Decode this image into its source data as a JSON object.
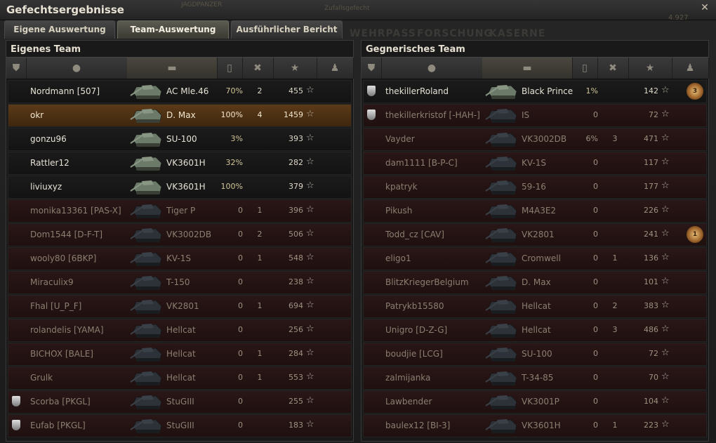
{
  "window": {
    "title": "Gefechtsergebnisse"
  },
  "background_ghosts": {
    "top_left": "JAGDPANZER",
    "top_mid": "Zufallsgefecht",
    "top_right_value": "4.927",
    "nav1": "WEHRPASS",
    "nav2": "FORSCHUNG",
    "nav3": "KASERNE"
  },
  "tabs": [
    {
      "label": "Eigene Auswertung"
    },
    {
      "label": "Team-Auswertung"
    },
    {
      "label": "Ausführlicher Bericht"
    }
  ],
  "column_icons": [
    "badge-icon",
    "player-icon",
    "tank-icon",
    "damage-icon",
    "kills-icon",
    "xp-icon",
    "medal-icon"
  ],
  "own_team": {
    "title": "Eigenes Team",
    "rows": [
      {
        "player": "Nordmann [507]",
        "tank": "AC Mle.46",
        "damage": "70%",
        "kills": "2",
        "xp": "455",
        "status": "alive",
        "badge": false,
        "medal": ""
      },
      {
        "player": "okr",
        "tank": "D. Max",
        "damage": "100%",
        "kills": "4",
        "xp": "1459",
        "status": "self",
        "badge": false,
        "medal": ""
      },
      {
        "player": "gonzu96",
        "tank": "SU-100",
        "damage": "3%",
        "kills": "",
        "xp": "393",
        "status": "alive",
        "badge": false,
        "medal": ""
      },
      {
        "player": "Rattler12",
        "tank": "VK3601H",
        "damage": "32%",
        "kills": "",
        "xp": "282",
        "status": "alive",
        "badge": false,
        "medal": ""
      },
      {
        "player": "liviuxyz",
        "tank": "VK3601H",
        "damage": "100%",
        "kills": "",
        "xp": "379",
        "status": "alive",
        "badge": false,
        "medal": ""
      },
      {
        "player": "monika13361 [PAS-X]",
        "tank": "Tiger P",
        "damage": "0",
        "kills": "1",
        "xp": "396",
        "status": "dead",
        "badge": false,
        "medal": ""
      },
      {
        "player": "Dom1544 [D-F-T]",
        "tank": "VK3002DB",
        "damage": "0",
        "kills": "2",
        "xp": "506",
        "status": "dead",
        "badge": false,
        "medal": ""
      },
      {
        "player": "wooly80 [6BKP]",
        "tank": "KV-1S",
        "damage": "0",
        "kills": "1",
        "xp": "548",
        "status": "dead",
        "badge": false,
        "medal": ""
      },
      {
        "player": "Miraculix9",
        "tank": "T-150",
        "damage": "0",
        "kills": "",
        "xp": "238",
        "status": "dead",
        "badge": false,
        "medal": ""
      },
      {
        "player": "Fhal [U_P_F]",
        "tank": "VK2801",
        "damage": "0",
        "kills": "1",
        "xp": "694",
        "status": "dead",
        "badge": false,
        "medal": ""
      },
      {
        "player": "rolandelis [YAMA]",
        "tank": "Hellcat",
        "damage": "0",
        "kills": "",
        "xp": "256",
        "status": "dead",
        "badge": false,
        "medal": ""
      },
      {
        "player": "BICHOX [BALE]",
        "tank": "Hellcat",
        "damage": "0",
        "kills": "1",
        "xp": "284",
        "status": "dead",
        "badge": false,
        "medal": ""
      },
      {
        "player": "Grulk",
        "tank": "Hellcat",
        "damage": "0",
        "kills": "1",
        "xp": "553",
        "status": "dead",
        "badge": false,
        "medal": ""
      },
      {
        "player": "Scorba [PKGL]",
        "tank": "StuGIII",
        "damage": "0",
        "kills": "",
        "xp": "255",
        "status": "dead",
        "badge": true,
        "medal": ""
      },
      {
        "player": "Eufab [PKGL]",
        "tank": "StuGIII",
        "damage": "0",
        "kills": "",
        "xp": "183",
        "status": "dead",
        "badge": true,
        "medal": ""
      }
    ]
  },
  "enemy_team": {
    "title": "Gegnerisches Team",
    "rows": [
      {
        "player": "thekillerRoland",
        "tank": "Black Prince",
        "damage": "1%",
        "kills": "",
        "xp": "142",
        "status": "alive",
        "badge": true,
        "medal": "3"
      },
      {
        "player": "thekillerkristof [-HAH-]",
        "tank": "IS",
        "damage": "0",
        "kills": "",
        "xp": "72",
        "status": "dead",
        "badge": true,
        "medal": ""
      },
      {
        "player": "Vayder",
        "tank": "VK3002DB",
        "damage": "6%",
        "kills": "3",
        "xp": "471",
        "status": "dead",
        "badge": false,
        "medal": ""
      },
      {
        "player": "dam1111 [B-P-C]",
        "tank": "KV-1S",
        "damage": "0",
        "kills": "",
        "xp": "117",
        "status": "dead",
        "badge": false,
        "medal": ""
      },
      {
        "player": "kpatryk",
        "tank": "59-16",
        "damage": "0",
        "kills": "",
        "xp": "177",
        "status": "dead",
        "badge": false,
        "medal": ""
      },
      {
        "player": "Pikush",
        "tank": "M4A3E2",
        "damage": "0",
        "kills": "",
        "xp": "226",
        "status": "dead",
        "badge": false,
        "medal": ""
      },
      {
        "player": "Todd_cz [CAV]",
        "tank": "VK2801",
        "damage": "0",
        "kills": "",
        "xp": "241",
        "status": "dead",
        "badge": false,
        "medal": "1"
      },
      {
        "player": "eligo1",
        "tank": "Cromwell",
        "damage": "0",
        "kills": "1",
        "xp": "136",
        "status": "dead",
        "badge": false,
        "medal": ""
      },
      {
        "player": "BlitzKriegerBelgium",
        "tank": "D. Max",
        "damage": "0",
        "kills": "",
        "xp": "101",
        "status": "dead",
        "badge": false,
        "medal": ""
      },
      {
        "player": "Patrykb15580",
        "tank": "Hellcat",
        "damage": "0",
        "kills": "2",
        "xp": "383",
        "status": "dead",
        "badge": false,
        "medal": ""
      },
      {
        "player": "Unigro [D-Z-G]",
        "tank": "Hellcat",
        "damage": "0",
        "kills": "3",
        "xp": "486",
        "status": "dead",
        "badge": false,
        "medal": ""
      },
      {
        "player": "boudjie [LCG]",
        "tank": "SU-100",
        "damage": "0",
        "kills": "",
        "xp": "72",
        "status": "dead",
        "badge": false,
        "medal": ""
      },
      {
        "player": "zalmijanka",
        "tank": "T-34-85",
        "damage": "0",
        "kills": "",
        "xp": "70",
        "status": "dead",
        "badge": false,
        "medal": ""
      },
      {
        "player": "Lawbender",
        "tank": "VK3001P",
        "damage": "0",
        "kills": "",
        "xp": "104",
        "status": "dead",
        "badge": false,
        "medal": ""
      },
      {
        "player": "baulex12 [BI-3]",
        "tank": "VK3601H",
        "damage": "0",
        "kills": "1",
        "xp": "223",
        "status": "dead",
        "badge": false,
        "medal": ""
      }
    ]
  }
}
